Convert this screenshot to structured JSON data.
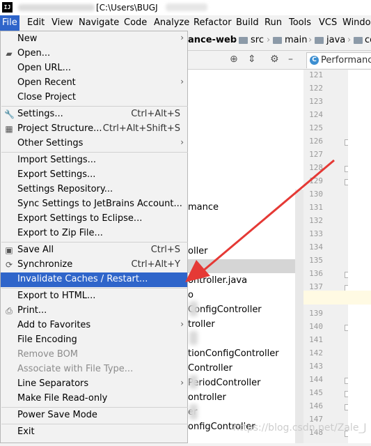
{
  "title_bar": {
    "app_logo": "IJ",
    "text": "[C:\\Users\\BUGJ"
  },
  "menu_bar": [
    "File",
    "Edit",
    "View",
    "Navigate",
    "Code",
    "Analyze",
    "Refactor",
    "Build",
    "Run",
    "Tools",
    "VCS",
    "Window"
  ],
  "nav_bar": {
    "crumbs": [
      "ance-web",
      "src",
      "main",
      "java",
      "co"
    ]
  },
  "editor_tab": {
    "label": "Performance",
    "icon": "class-icon"
  },
  "line_numbers": [
    "121",
    "122",
    "123",
    "124",
    "125",
    "126",
    "127",
    "128",
    "129",
    "130",
    "131",
    "132",
    "133",
    "134",
    "135",
    "136",
    "137",
    "138",
    "139",
    "140",
    "141",
    "142",
    "143",
    "144",
    "145",
    "146",
    "147",
    "148"
  ],
  "project_tree": [
    "mance",
    "oller",
    "ontroller.java",
    "o",
    "ConfigController",
    "troller",
    "tionConfigController",
    "Controller",
    "PeriodController",
    "ontroller",
    "er",
    "onfigController",
    "ScoreProcessCo"
  ],
  "file_menu": {
    "groups": [
      [
        {
          "label": "New",
          "shortcut": "",
          "submenu": true,
          "icon": ""
        },
        {
          "label": "Open...",
          "shortcut": "",
          "submenu": false,
          "icon": "folder-open-icon"
        },
        {
          "label": "Open URL...",
          "shortcut": "",
          "submenu": false,
          "icon": ""
        },
        {
          "label": "Open Recent",
          "shortcut": "",
          "submenu": true,
          "icon": ""
        },
        {
          "label": "Close Project",
          "shortcut": "",
          "submenu": false,
          "icon": ""
        }
      ],
      [
        {
          "label": "Settings...",
          "shortcut": "Ctrl+Alt+S",
          "submenu": false,
          "icon": "wrench-icon"
        },
        {
          "label": "Project Structure...",
          "shortcut": "Ctrl+Alt+Shift+S",
          "submenu": false,
          "icon": "project-structure-icon"
        },
        {
          "label": "Other Settings",
          "shortcut": "",
          "submenu": true,
          "icon": ""
        }
      ],
      [
        {
          "label": "Import Settings...",
          "shortcut": "",
          "submenu": false,
          "icon": ""
        },
        {
          "label": "Export Settings...",
          "shortcut": "",
          "submenu": false,
          "icon": ""
        },
        {
          "label": "Settings Repository...",
          "shortcut": "",
          "submenu": false,
          "icon": ""
        },
        {
          "label": "Sync Settings to JetBrains Account...",
          "shortcut": "",
          "submenu": false,
          "icon": ""
        },
        {
          "label": "Export Settings to Eclipse...",
          "shortcut": "",
          "submenu": false,
          "icon": ""
        },
        {
          "label": "Export to Zip File...",
          "shortcut": "",
          "submenu": false,
          "icon": ""
        }
      ],
      [
        {
          "label": "Save All",
          "shortcut": "Ctrl+S",
          "submenu": false,
          "icon": "save-icon"
        },
        {
          "label": "Synchronize",
          "shortcut": "Ctrl+Alt+Y",
          "submenu": false,
          "icon": "sync-icon"
        },
        {
          "label": "Invalidate Caches / Restart...",
          "shortcut": "",
          "submenu": false,
          "icon": "",
          "selected": true
        }
      ],
      [
        {
          "label": "Export to HTML...",
          "shortcut": "",
          "submenu": false,
          "icon": ""
        },
        {
          "label": "Print...",
          "shortcut": "",
          "submenu": false,
          "icon": "print-icon"
        },
        {
          "label": "Add to Favorites",
          "shortcut": "",
          "submenu": true,
          "icon": ""
        },
        {
          "label": "File Encoding",
          "shortcut": "",
          "submenu": false,
          "icon": ""
        },
        {
          "label": "Remove BOM",
          "shortcut": "",
          "submenu": false,
          "icon": "",
          "disabled": true
        },
        {
          "label": "Associate with File Type...",
          "shortcut": "",
          "submenu": false,
          "icon": "",
          "disabled": true
        },
        {
          "label": "Line Separators",
          "shortcut": "",
          "submenu": true,
          "icon": ""
        },
        {
          "label": "Make File Read-only",
          "shortcut": "",
          "submenu": false,
          "icon": ""
        }
      ],
      [
        {
          "label": "Power Save Mode",
          "shortcut": "",
          "submenu": false,
          "icon": ""
        }
      ],
      [
        {
          "label": "Exit",
          "shortcut": "",
          "submenu": false,
          "icon": ""
        }
      ]
    ]
  },
  "watermark": "https://blog.csdn.net/Zale_J",
  "colors": {
    "selection": "#2f65ca",
    "arrow": "#e53935",
    "menu_bg": "#f2f2f2"
  }
}
